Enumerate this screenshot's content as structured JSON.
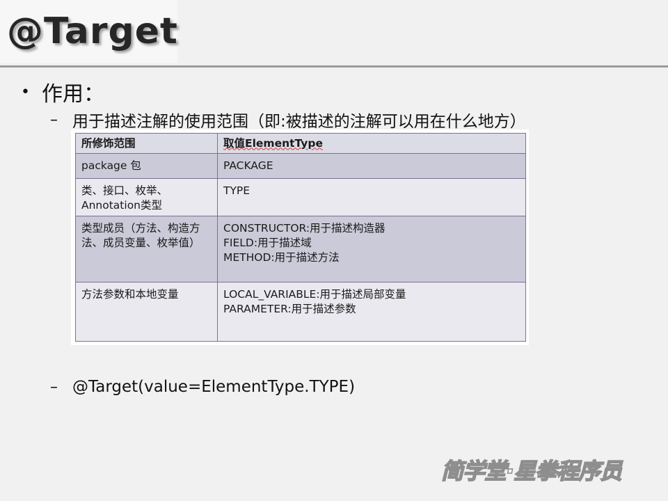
{
  "slide": {
    "title": "@Target",
    "bullet": "作用：",
    "sub1": "用于描述注解的使用范围（即:被描述的注解可以用在什么地方）",
    "sub2": "@Target(value=ElementType.TYPE)",
    "bullet_symbol": "•",
    "dash_symbol": "–"
  },
  "table": {
    "headers": [
      "所修饰范围",
      "取值ElementType"
    ],
    "rows": [
      {
        "scope": "package  包",
        "values": [
          "PACKAGE"
        ]
      },
      {
        "scope": "类、接口、枚举、Annotation类型",
        "values": [
          "TYPE"
        ]
      },
      {
        "scope": "类型成员（方法、构造方法、成员变量、枚举值）",
        "values": [
          "CONSTRUCTOR:用于描述构造器",
          "FIELD:用于描述域",
          "METHOD:用于描述方法"
        ]
      },
      {
        "scope": "方法参数和本地变量",
        "values": [
          "LOCAL_VARIABLE:用于描述局部变量",
          "PARAMETER:用于描述参数"
        ]
      }
    ]
  },
  "watermark": {
    "text": "简学堂·星拳程序员",
    "color": "#9a9a9a"
  }
}
